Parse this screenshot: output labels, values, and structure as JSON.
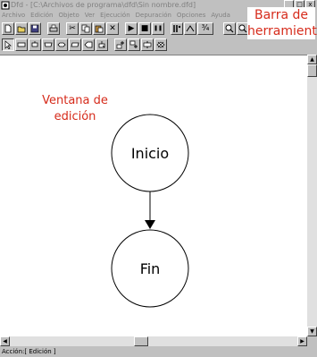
{
  "window": {
    "title": "Dfd - [C:\\Archivos de programa\\dfd\\Sin nombre.dfd]",
    "controls": [
      "_",
      "□",
      "x"
    ]
  },
  "menu": {
    "items": [
      "Archivo",
      "Edición",
      "Objeto",
      "Ver",
      "Ejecución",
      "Depuración",
      "Opciones",
      "Ayuda"
    ]
  },
  "toolbar1": {
    "buttons": [
      {
        "icon": "new-file-icon",
        "glyph": ""
      },
      {
        "icon": "open-folder-icon",
        "glyph": ""
      },
      {
        "icon": "save-icon",
        "glyph": ""
      },
      {
        "icon": "print-icon",
        "glyph": ""
      },
      {
        "icon": "cut-icon",
        "glyph": "✂"
      },
      {
        "icon": "copy-icon",
        "glyph": ""
      },
      {
        "icon": "paste-icon",
        "glyph": ""
      },
      {
        "icon": "delete-icon",
        "glyph": "✕"
      },
      {
        "icon": "run-icon",
        "glyph": "▶"
      },
      {
        "icon": "stop-icon",
        "glyph": "■"
      },
      {
        "icon": "pause-icon",
        "glyph": "❚❚"
      },
      {
        "icon": "step-icon",
        "glyph": ""
      },
      {
        "icon": "trace-icon",
        "glyph": ""
      },
      {
        "icon": "watch-icon",
        "glyph": "¾"
      },
      {
        "icon": "zoom-in-icon",
        "glyph": ""
      },
      {
        "icon": "zoom-out-icon",
        "glyph": ""
      }
    ]
  },
  "toolbar2": {
    "buttons": [
      {
        "icon": "pointer-icon"
      },
      {
        "icon": "assignment-block-icon"
      },
      {
        "icon": "loop-icon"
      },
      {
        "icon": "while-icon"
      },
      {
        "icon": "decision-icon"
      },
      {
        "icon": "read-icon"
      },
      {
        "icon": "write-icon"
      },
      {
        "icon": "subprogram-icon"
      },
      {
        "icon": "insert-object-icon"
      },
      {
        "icon": "insert-below-icon"
      },
      {
        "icon": "connect-icon"
      },
      {
        "icon": "close-object-icon"
      }
    ]
  },
  "annotations": {
    "toolbar_label": "Barra de herramientas",
    "edit_label": "Ventana de edición"
  },
  "flowchart": {
    "start_label": "Inicio",
    "end_label": "Fin"
  },
  "statusbar": {
    "text": "Acción:[ Edición ]"
  },
  "colors": {
    "annotation": "#d62b1b",
    "chrome": "#c0c0c0"
  }
}
